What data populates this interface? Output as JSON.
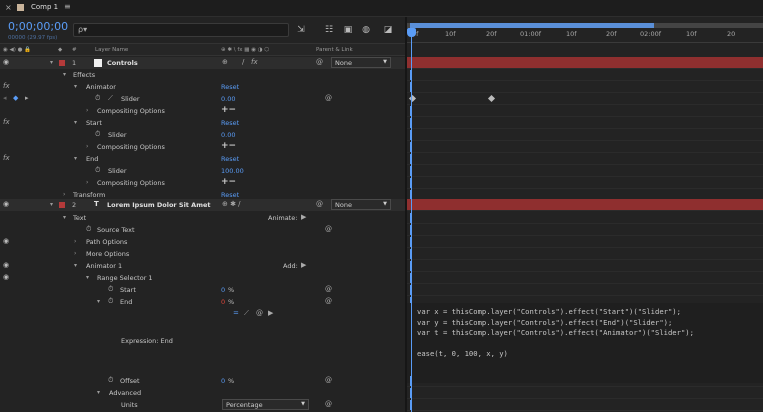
{
  "tab": {
    "close": "×",
    "name": "Comp 1",
    "menu": "≡"
  },
  "header": {
    "timecode": "0;00;00;00",
    "fps": "00000 (29.97 fps)",
    "search_icon": "ρ▾",
    "icons": [
      "comp-mini-flowchart-icon",
      "draft-3d-icon",
      "shy-icon",
      "frame-blending-icon",
      "motion-blur-icon",
      "graph-editor-icon"
    ]
  },
  "columns": {
    "layer_name": "Layer Name",
    "parent_link": "Parent & Link",
    "switch_glyphs": "⊕ ✱ \\ fx ▦ ◉ ◑ ⬡",
    "hash": "#"
  },
  "rows": [
    {
      "key": "l1",
      "name": "Controls",
      "number": "1",
      "parent": "None"
    },
    {
      "key": "effects",
      "label": "Effects"
    },
    {
      "key": "animator",
      "label": "Animator",
      "value": "Reset"
    },
    {
      "key": "animator_slider",
      "label": "Slider",
      "value": "0.00"
    },
    {
      "key": "animator_comp",
      "label": "Compositing Options",
      "value": "+−"
    },
    {
      "key": "start",
      "label": "Start",
      "value": "Reset"
    },
    {
      "key": "start_slider",
      "label": "Slider",
      "value": "0.00"
    },
    {
      "key": "start_comp",
      "label": "Compositing Options",
      "value": "+−"
    },
    {
      "key": "end",
      "label": "End",
      "value": "Reset"
    },
    {
      "key": "end_slider",
      "label": "Slider",
      "value": "100.00"
    },
    {
      "key": "end_comp",
      "label": "Compositing Options",
      "value": "+−"
    },
    {
      "key": "transform",
      "label": "Transform",
      "value": "Reset"
    },
    {
      "key": "l2",
      "name": "Lorem Ipsum Dolor Sit Amet",
      "number": "2",
      "parent": "None"
    },
    {
      "key": "text",
      "label": "Text",
      "value": "Animate:"
    },
    {
      "key": "source_text",
      "label": "Source Text"
    },
    {
      "key": "path_options",
      "label": "Path Options"
    },
    {
      "key": "more_options",
      "label": "More Options"
    },
    {
      "key": "animator1",
      "label": "Animator 1",
      "value": "Add:"
    },
    {
      "key": "range_selector",
      "label": "Range Selector 1"
    },
    {
      "key": "rs_start",
      "label": "Start",
      "value": "0",
      "unit": "%"
    },
    {
      "key": "rs_end",
      "label": "End",
      "value": "0",
      "unit": "%"
    },
    {
      "key": "expr_label",
      "label": "Expression: End"
    },
    {
      "key": "offset",
      "label": "Offset",
      "value": "0",
      "unit": "%"
    },
    {
      "key": "advanced",
      "label": "Advanced"
    },
    {
      "key": "units",
      "label": "Units",
      "value": "Percentage"
    }
  ],
  "ruler": [
    "0f",
    "10f",
    "20f",
    "01:00f",
    "10f",
    "20f",
    "02:00f",
    "10f",
    "20"
  ],
  "expression": "var x = thisComp.layer(\"Controls\").effect(\"Start\")(\"Slider\");\nvar y = thisComp.layer(\"Controls\").effect(\"End\")(\"Slider\");\nvar t = thisComp.layer(\"Controls\").effect(\"Animator\")(\"Slider\");\n\nease(t, 0, 100, x, y)",
  "colors": {
    "accent": "#5a9cf6",
    "layer_red": "#8f2f2f",
    "label_red": "#b43a3a"
  }
}
